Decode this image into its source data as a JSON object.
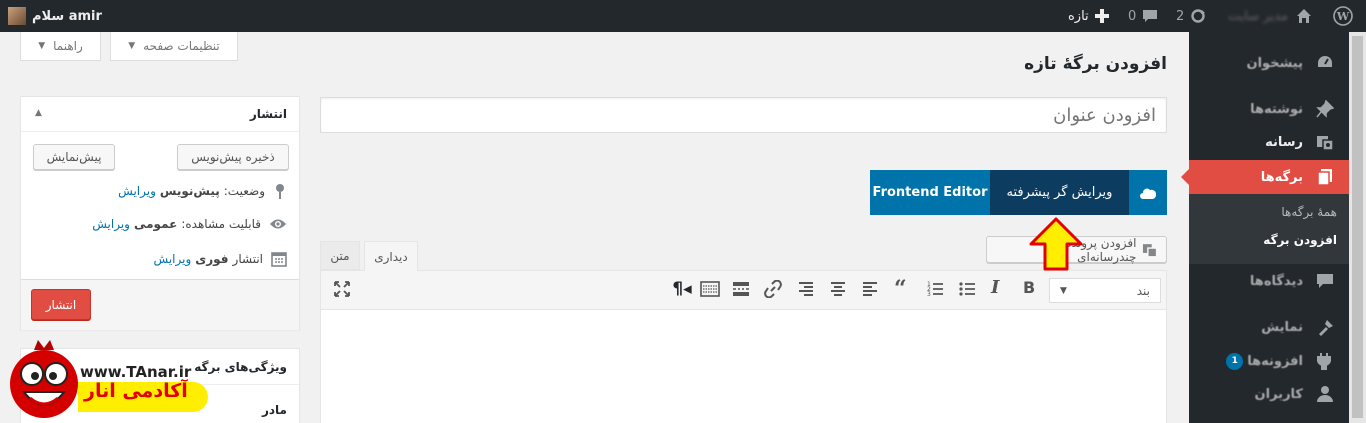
{
  "colors": {
    "admin_bg": "#23282d",
    "menu_active": "#e14d43",
    "link": "#0073aa",
    "vc_blue": "#0073aa",
    "vc_dark": "#0d3c61",
    "publish_red": "#e14d43",
    "arrow_yellow": "#ffee00",
    "arrow_red": "#e40000"
  },
  "admin_bar": {
    "greeting": "سلام amir",
    "site_name": "مدیر سایت",
    "updates_count": "2",
    "comments_count": "0",
    "new_label": "تازه"
  },
  "screen_meta": {
    "options_label": "تنظیمات صفحه",
    "help_label": "راهنما"
  },
  "page": {
    "title": "افزودن برگهٔ تازه",
    "title_placeholder": "افزودن عنوان"
  },
  "builder": {
    "advanced_label": "ویرایش گر پیشرفته",
    "frontend_label": "Frontend Editor"
  },
  "editor": {
    "add_media_label": "افزودن پرونده‌های چندرسانه‌ای",
    "tab_visual": "دیداری",
    "tab_text": "متن",
    "format_select": "بند",
    "toolbar_icons": [
      "bold-icon",
      "italic-icon",
      "bullet-list-icon",
      "number-list-icon",
      "blockquote-icon",
      "align-left-icon",
      "align-center-icon",
      "align-right-icon",
      "link-icon",
      "read-more-icon",
      "toolbar-toggle-icon",
      "paragraph-icon"
    ],
    "fullscreen_icon": "fullscreen-icon"
  },
  "publish_box": {
    "title": "انتشار",
    "save_draft": "ذخیره پیش‌نویس",
    "preview": "پیش‌نمایش",
    "status_label": "وضعیت:",
    "status_value": "پیش‌نویس",
    "visibility_label": "قابلیت مشاهده:",
    "visibility_value": "عمومی",
    "schedule_label": "انتشار",
    "schedule_value": "فوری",
    "edit_link": "ویرایش",
    "publish_button": "انتشار"
  },
  "page_attributes": {
    "title": "ویژگی‌های برگه",
    "parent_label": "مادر"
  },
  "admin_menu": {
    "items": [
      {
        "label": "پیشخوان",
        "icon": "dashboard-icon"
      },
      {
        "label": "نوشته‌ها",
        "icon": "pin-icon"
      },
      {
        "label": "رسانه",
        "icon": "media-icon"
      },
      {
        "label": "برگه‌ها",
        "icon": "pages-icon"
      },
      {
        "label": "دیدگاه‌ها",
        "icon": "comments-icon"
      },
      {
        "label": "نمایش",
        "icon": "appearance-icon"
      },
      {
        "label": "افزونه‌ها",
        "icon": "plugins-icon",
        "badge": "1"
      },
      {
        "label": "کاربران",
        "icon": "users-icon"
      }
    ],
    "submenu": [
      "همهٔ برگه‌ها",
      "افزودن برگه"
    ]
  },
  "watermark": {
    "url": "www.TAnar.ir",
    "name": "آکادمی انار"
  }
}
